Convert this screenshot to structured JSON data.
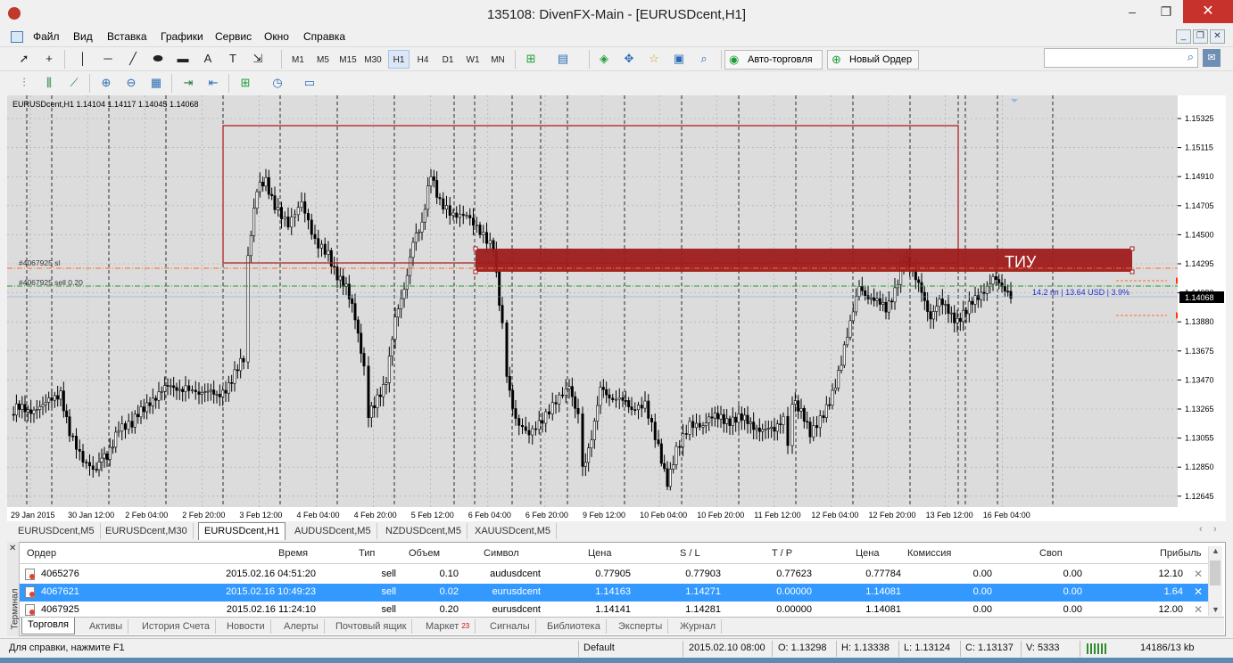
{
  "window": {
    "title": "135108: DivenFX-Main - [EURUSDcent,H1]",
    "minimize": "–",
    "restore": "❐",
    "close": "✕"
  },
  "menu": [
    "Файл",
    "Вид",
    "Вставка",
    "Графики",
    "Сервис",
    "Окно",
    "Справка"
  ],
  "mdi": {
    "minimize": "_",
    "restore": "❐",
    "close": "✕"
  },
  "toolbar": {
    "timeframes": [
      "M1",
      "M5",
      "M15",
      "M30",
      "H1",
      "H4",
      "D1",
      "W1",
      "MN"
    ],
    "active_timeframe": "H1",
    "text_tool": "A",
    "autotrade_label": "Авто-торговля",
    "new_order_label": "Новый Ордер",
    "search_placeholder": ""
  },
  "chart": {
    "header": "EURUSDcent,H1  1.14104 1.14117 1.14045 1.14068",
    "current_price": "1.14068",
    "price_ticks": [
      "1.15325",
      "1.15115",
      "1.14910",
      "1.14705",
      "1.14500",
      "1.14295",
      "1.14090",
      "1.13880",
      "1.13675",
      "1.13470",
      "1.13265",
      "1.13055",
      "1.12850",
      "1.12645"
    ],
    "time_ticks": [
      "29 Jan 2015",
      "30 Jan 12:00",
      "2 Feb 04:00",
      "2 Feb 20:00",
      "3 Feb 12:00",
      "4 Feb 04:00",
      "4 Feb 20:00",
      "5 Feb 12:00",
      "6 Feb 04:00",
      "6 Feb 20:00",
      "9 Feb 12:00",
      "10 Feb 04:00",
      "10 Feb 20:00",
      "11 Feb 12:00",
      "12 Feb 04:00",
      "12 Feb 20:00",
      "13 Feb 12:00",
      "16 Feb 04:00"
    ],
    "sl_label": "#4067925 sl",
    "sell_label": "#4067925 sell 0.20",
    "zone_label": "ТИУ",
    "profit_info": "14.2 пп | 13.64 USD | 3.9%",
    "colors": {
      "zone": "#9e1b1b",
      "box": "#b22222",
      "sl_line": "#ff6a2a",
      "sell_line": "#1f9e2f",
      "price_bg": "#000000"
    }
  },
  "chart_tabs": [
    "EURUSDcent,M5",
    "EURUSDcent,M30",
    "EURUSDcent,H1",
    "AUDUSDcent,M5",
    "NZDUSDcent,M5",
    "XAUUSDcent,M5"
  ],
  "active_chart_tab": "EURUSDcent,H1",
  "terminal": {
    "side_label": "Терминал",
    "columns": [
      "Ордер",
      "Время",
      "Тип",
      "Объем",
      "Символ",
      "Цена",
      "S / L",
      "T / P",
      "Цена",
      "Комиссия",
      "Своп",
      "Прибыль"
    ],
    "rows": [
      {
        "order": "4065276",
        "time": "2015.02.16 04:51:20",
        "type": "sell",
        "volume": "0.10",
        "symbol": "audusdcent",
        "price": "0.77905",
        "sl": "0.77903",
        "tp": "0.77623",
        "cur": "0.77784",
        "commission": "0.00",
        "swap": "0.00",
        "profit": "12.10"
      },
      {
        "order": "4067621",
        "time": "2015.02.16 10:49:23",
        "type": "sell",
        "volume": "0.02",
        "symbol": "eurusdcent",
        "price": "1.14163",
        "sl": "1.14271",
        "tp": "0.00000",
        "cur": "1.14081",
        "commission": "0.00",
        "swap": "0.00",
        "profit": "1.64"
      },
      {
        "order": "4067925",
        "time": "2015.02.16 11:24:10",
        "type": "sell",
        "volume": "0.20",
        "symbol": "eurusdcent",
        "price": "1.14141",
        "sl": "1.14281",
        "tp": "0.00000",
        "cur": "1.14081",
        "commission": "0.00",
        "swap": "0.00",
        "profit": "12.00"
      }
    ],
    "tabs": [
      "Торговля",
      "Активы",
      "История Счета",
      "Новости",
      "Алерты",
      "Почтовый ящик",
      "Маркет",
      "Сигналы",
      "Библиотека",
      "Эксперты",
      "Журнал"
    ],
    "market_badge": "23",
    "active_tab": "Торговля"
  },
  "status": {
    "help": "Для справки, нажмите F1",
    "profile": "Default",
    "datetime": "2015.02.10 08:00",
    "open": "O: 1.13298",
    "high": "H: 1.13338",
    "low": "L: 1.13124",
    "close": "C: 1.13137",
    "volume": "V: 5333",
    "traffic": "14186/13 kb"
  }
}
